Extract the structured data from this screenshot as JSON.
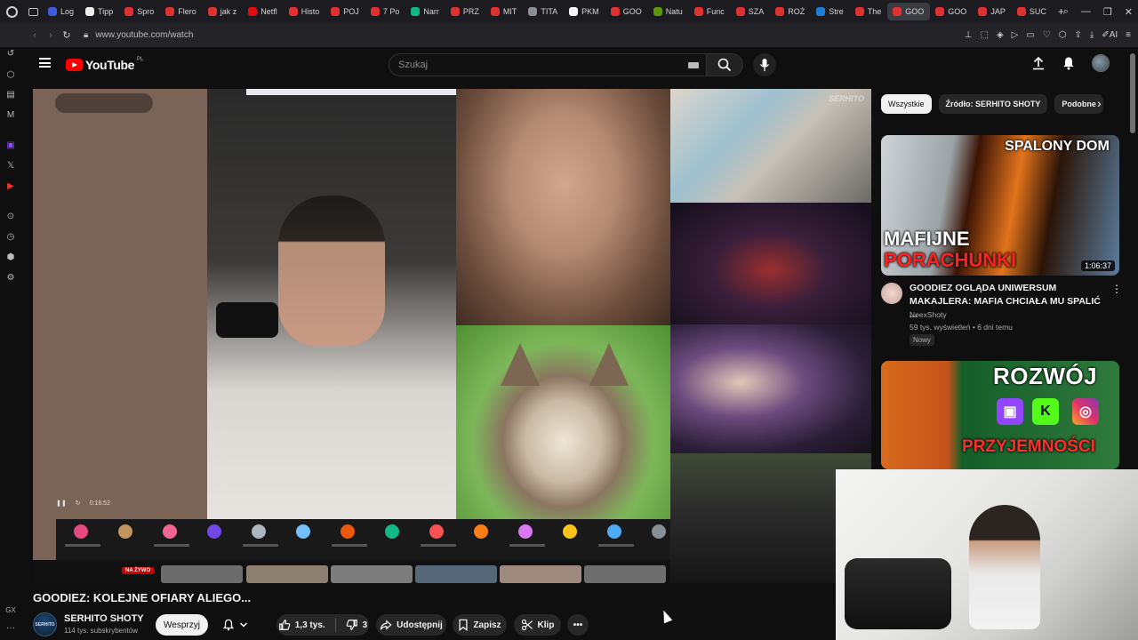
{
  "browser": {
    "tabs": [
      {
        "label": "Log",
        "color": "#3b5bdb"
      },
      {
        "label": "Tipp",
        "color": "#eeeeee"
      },
      {
        "label": "Spro",
        "color": "#e03131"
      },
      {
        "label": "Flero",
        "color": "#e03131"
      },
      {
        "label": "jak z",
        "color": "#e03131"
      },
      {
        "label": "Netfl",
        "color": "#e50914"
      },
      {
        "label": "Histo",
        "color": "#e03131"
      },
      {
        "label": "POJ",
        "color": "#e03131"
      },
      {
        "label": "7 Po",
        "color": "#e03131"
      },
      {
        "label": "Narr",
        "color": "#12b886"
      },
      {
        "label": "PRZ",
        "color": "#e03131"
      },
      {
        "label": "MIT",
        "color": "#e03131"
      },
      {
        "label": "TITA",
        "color": "#868e96"
      },
      {
        "label": "PKM",
        "color": "#f1f3f5"
      },
      {
        "label": "GOO",
        "color": "#e03131"
      },
      {
        "label": "Natu",
        "color": "#5c940d"
      },
      {
        "label": "Func",
        "color": "#e03131"
      },
      {
        "label": "SZA",
        "color": "#e03131"
      },
      {
        "label": "ROŻ",
        "color": "#e03131"
      },
      {
        "label": "Stre",
        "color": "#1c7ed6"
      },
      {
        "label": "The",
        "color": "#e03131"
      },
      {
        "label": "GOO",
        "color": "#e03131",
        "active": true
      },
      {
        "label": "GOO",
        "color": "#e03131"
      },
      {
        "label": "JAP",
        "color": "#e03131"
      },
      {
        "label": "SUC",
        "color": "#e03131"
      }
    ],
    "url": "www.youtube.com/watch"
  },
  "youtube": {
    "logo_text": "YouTube",
    "country_code": "PL",
    "search_placeholder": "Szukaj",
    "video": {
      "title": "GOODIEZ: KOLEJNE OFIARY ALIEGO...",
      "channel_name": "SERHITO SHOTY",
      "subscribers": "114 tys. subskrybentów",
      "channel_avatar_text": "SERHITO",
      "join_label": "Wesprzyj",
      "likes": "1,3 tys.",
      "dislikes": "3",
      "share_label": "Udostępnij",
      "save_label": "Zapisz",
      "clip_label": "Klip",
      "player_time": "0:16:52",
      "live_badge": "NA ŻYWO",
      "watermark": "SERHITO"
    },
    "chips": [
      {
        "label": "Wszystkie",
        "selected": true
      },
      {
        "label": "Źródło: SERHITO SHOTY"
      },
      {
        "label": "Podobne"
      }
    ],
    "related": [
      {
        "thumb_text_1": "SPALONY DOM",
        "thumb_text_2": "MAFIJNE",
        "thumb_text_3": "PORACHUNKI",
        "duration": "1:06:37",
        "title": "GOODIEZ OGLĄDA UNIWERSUM MAKAJLERA: MAFIA CHCIAŁA MU SPALIĆ ...",
        "channel": "NeexShoty",
        "stats": "59 tys. wyświetleń • 6 dni temu",
        "badge": "Nowy"
      },
      {
        "thumb_text_1": "ROZWÓJ",
        "thumb_text_2": "PRZYJEMNOŚCI"
      }
    ]
  },
  "sidebar_labels": {
    "gx": "GX"
  }
}
